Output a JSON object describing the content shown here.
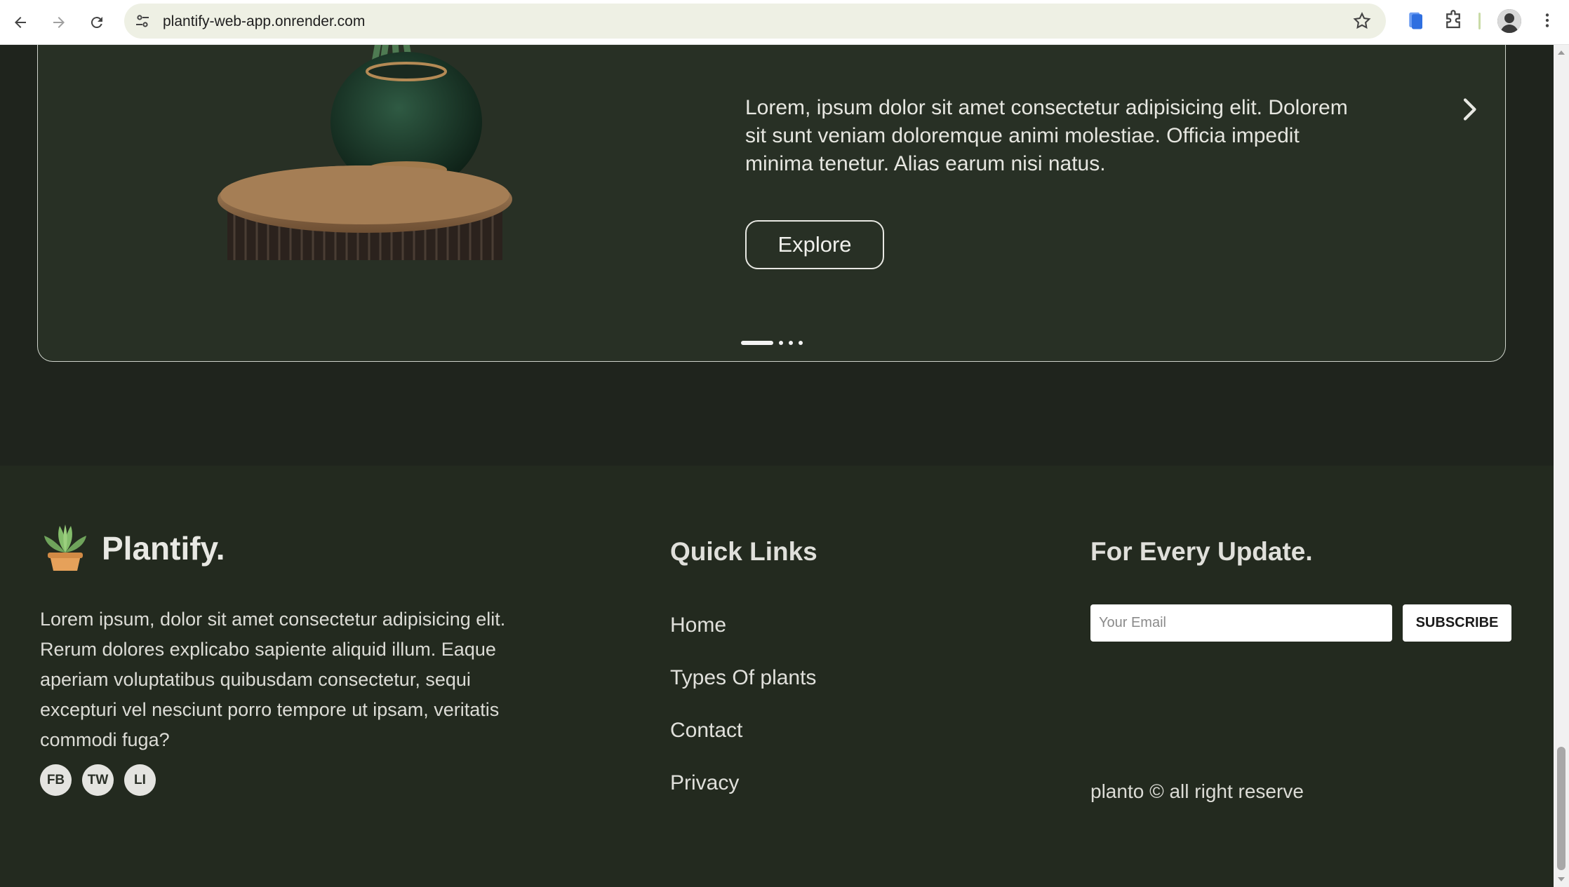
{
  "browser": {
    "url": "plantify-web-app.onrender.com"
  },
  "hero": {
    "description": "Lorem, ipsum dolor sit amet consectetur adipisicing elit. Dolorem sit sunt veniam doloremque animi molestiae. Officia impedit minima tenetur. Alias earum nisi natus.",
    "button_label": "Explore",
    "slide_count": 4,
    "active_slide": 1
  },
  "footer": {
    "brand": {
      "name": "Plantify.",
      "icon": "succulent-pot-icon"
    },
    "about": "Lorem ipsum, dolor sit amet consectetur adipisicing elit. Rerum dolores explicabo sapiente aliquid illum. Eaque aperiam voluptatibus quibusdam consectetur, sequi excepturi vel nesciunt porro tempore ut ipsam, veritatis commodi fuga?",
    "socials": [
      "FB",
      "TW",
      "LI"
    ],
    "quick_links": {
      "title": "Quick Links",
      "items": [
        "Home",
        "Types Of plants",
        "Contact",
        "Privacy"
      ]
    },
    "newsletter": {
      "title": "For Every Update.",
      "email_placeholder": "Your Email",
      "button_label": "SUBSCRIBE"
    },
    "copyright": "planto © all right reserve"
  },
  "colors": {
    "page_bg": "#1f241d",
    "hero_bg": "#283025",
    "footer_bg": "#232a1f",
    "text": "#e0e0db"
  }
}
